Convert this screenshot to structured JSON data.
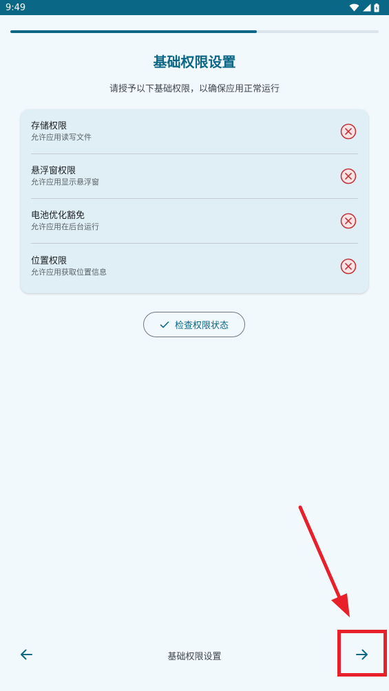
{
  "status_bar": {
    "time": "9:49",
    "icons": [
      "wifi-icon",
      "signal-icon",
      "battery-icon"
    ],
    "background": "#0a6785"
  },
  "progress": {
    "value_fraction": 0.67,
    "color": "#0a6785"
  },
  "header": {
    "title": "基础权限设置",
    "subtitle": "请授予以下基础权限，以确保应用正常运行"
  },
  "permissions": [
    {
      "name": "存储权限",
      "description": "允许应用读写文件",
      "status": "denied",
      "status_icon": "close-circle-icon"
    },
    {
      "name": "悬浮窗权限",
      "description": "允许应用显示悬浮窗",
      "status": "denied",
      "status_icon": "close-circle-icon"
    },
    {
      "name": "电池优化豁免",
      "description": "允许应用在后台运行",
      "status": "denied",
      "status_icon": "close-circle-icon"
    },
    {
      "name": "位置权限",
      "description": "允许应用获取位置信息",
      "status": "denied",
      "status_icon": "close-circle-icon"
    }
  ],
  "check_button": {
    "label": "检查权限状态",
    "icon": "check-icon"
  },
  "bottom_nav": {
    "back_icon": "arrow-left-icon",
    "label": "基础权限设置",
    "next_icon": "arrow-right-icon"
  },
  "colors": {
    "accent": "#0a6785",
    "error": "#c0343c",
    "annotation": "#e8202a"
  }
}
